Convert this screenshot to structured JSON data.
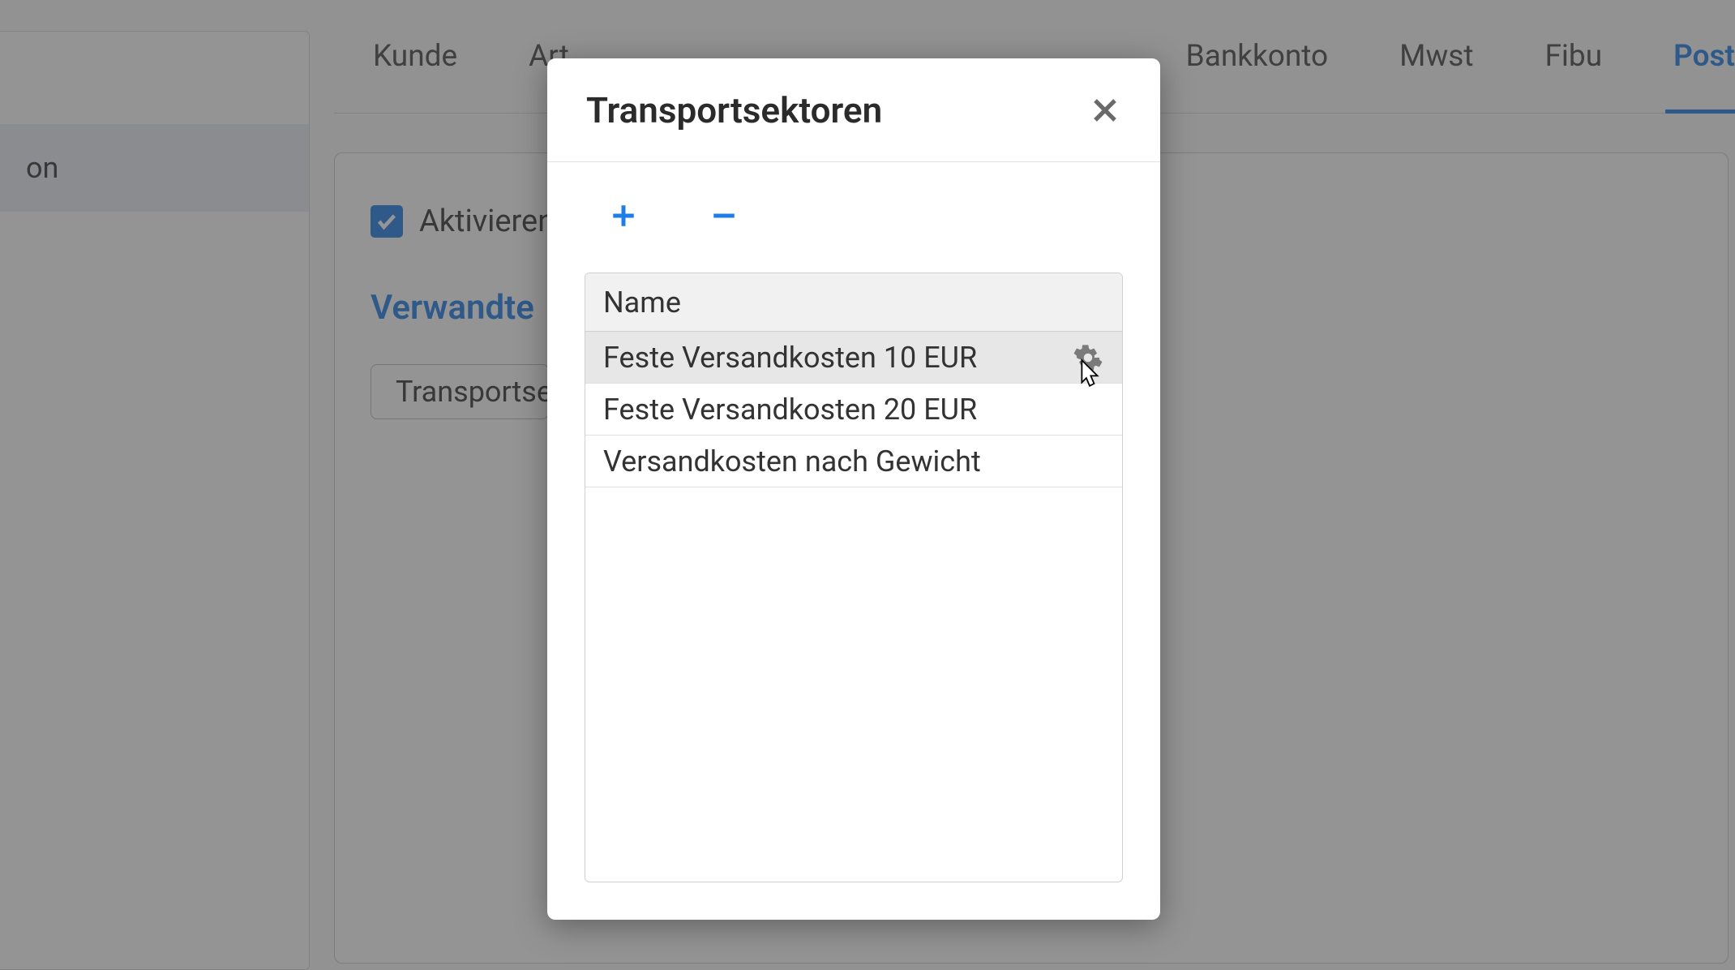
{
  "sidebar": {
    "active_item_label_fragment": "on"
  },
  "tabs": {
    "items": [
      {
        "label": "Kunde",
        "active": false
      },
      {
        "label": "Art",
        "active": false
      },
      {
        "label": "Bankkonto",
        "active": false
      },
      {
        "label": "Mwst",
        "active": false
      },
      {
        "label": "Fibu",
        "active": false
      },
      {
        "label": "Post",
        "active": true
      }
    ]
  },
  "content": {
    "activate_label": "Aktivieren",
    "activate_checked": true,
    "related_heading": "Verwandte",
    "transport_button_label_fragment": "Transportsekt"
  },
  "modal": {
    "title": "Transportsektoren",
    "column_header": "Name",
    "rows": [
      {
        "name": "Feste Versandkosten 10 EUR",
        "selected": true,
        "gear": true
      },
      {
        "name": "Feste Versandkosten 20 EUR",
        "selected": false,
        "gear": false
      },
      {
        "name": "Versandkosten nach Gewicht",
        "selected": false,
        "gear": false
      }
    ]
  }
}
